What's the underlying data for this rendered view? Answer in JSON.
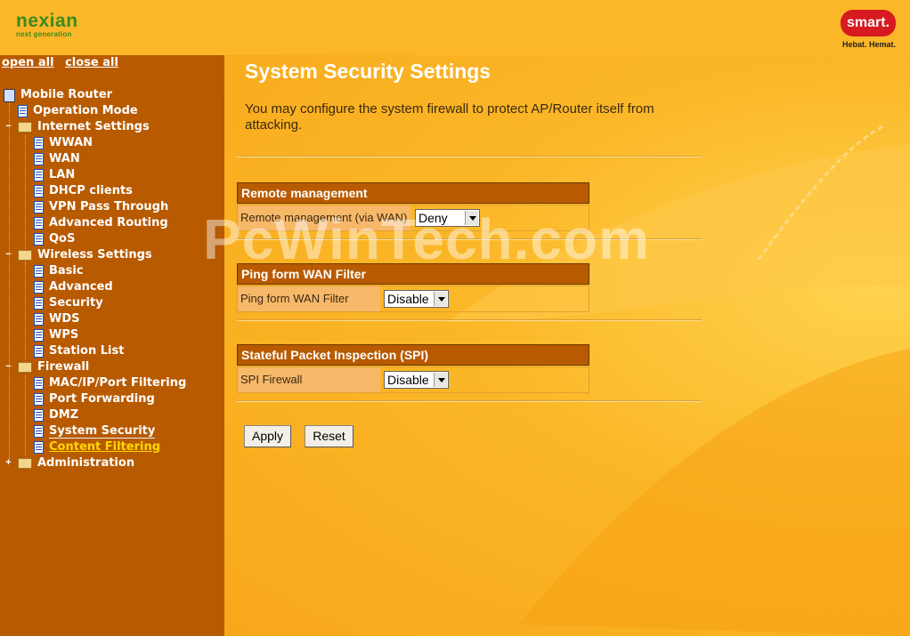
{
  "header": {
    "brand_left_line1": "nexian",
    "brand_left_line2": "next generation",
    "brand_right": "smart.",
    "brand_right_tagline": "Hebat. Hemat."
  },
  "sidebar": {
    "open_all": "open all",
    "close_all": "close all",
    "root": "Mobile Router",
    "items": {
      "operation_mode": "Operation Mode",
      "internet_settings": "Internet Settings",
      "wwan": "WWAN",
      "wan": "WAN",
      "lan": "LAN",
      "dhcp_clients": "DHCP clients",
      "vpn_pass_through": "VPN Pass Through",
      "advanced_routing": "Advanced Routing",
      "qos": "QoS",
      "wireless_settings": "Wireless Settings",
      "basic": "Basic",
      "advanced": "Advanced",
      "security": "Security",
      "wds": "WDS",
      "wps": "WPS",
      "station_list": "Station List",
      "firewall": "Firewall",
      "mac_ip_port_filtering": "MAC/IP/Port Filtering",
      "port_forwarding": "Port Forwarding",
      "dmz": "DMZ",
      "system_security": "System Security",
      "content_filtering": "Content Filtering",
      "administration": "Administration"
    }
  },
  "main": {
    "title": "System Security Settings",
    "intro": "You may configure the system firewall to protect AP/Router itself from attacking.",
    "remote": {
      "header": "Remote management",
      "label": "Remote management (via WAN)",
      "value": "Deny"
    },
    "ping": {
      "header": "Ping form WAN Filter",
      "label": "Ping form WAN Filter",
      "value": "Disable"
    },
    "spi": {
      "header": "Stateful Packet Inspection (SPI)",
      "label": "SPI Firewall",
      "value": "Disable"
    },
    "apply_label": "Apply",
    "reset_label": "Reset"
  },
  "watermark": "PcWinTech.com",
  "colors": {
    "background": "#fbb728",
    "sidebar": "#b85a00",
    "section_header": "#b85a00",
    "active_link": "#ffd700",
    "smart_red": "#d71920",
    "nexian_green": "#3a8a1f"
  }
}
